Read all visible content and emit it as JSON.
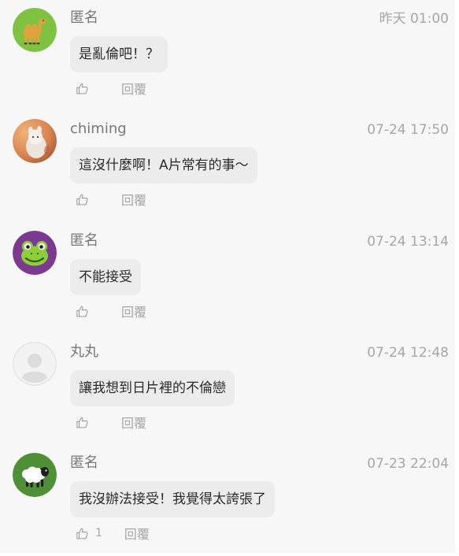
{
  "comments": [
    {
      "author": "匿名",
      "time": "昨天 01:00",
      "text": "是亂倫吧！？",
      "likes": "",
      "reply_label": "回覆",
      "avatar": {
        "icon": "camel-icon",
        "bg": "#7fc241",
        "fg": "#e0a23c"
      }
    },
    {
      "author": "chiming",
      "time": "07-24 17:50",
      "text": "這沒什麼啊！A片常有的事～",
      "likes": "",
      "reply_label": "回覆",
      "avatar": {
        "icon": "user-photo",
        "bg": "#d8824f",
        "fg": "#f3ece6"
      }
    },
    {
      "author": "匿名",
      "time": "07-24 13:14",
      "text": "不能接受",
      "likes": "",
      "reply_label": "回覆",
      "avatar": {
        "icon": "frog-icon",
        "bg": "#7b3a8f",
        "fg": "#8ccf3a"
      }
    },
    {
      "author": "丸丸",
      "time": "07-24 12:48",
      "text": "讓我想到日片裡的不倫戀",
      "likes": "",
      "reply_label": "回覆",
      "avatar": {
        "icon": "default-user-icon",
        "bg": "#f2f2f2",
        "fg": "#dddddd"
      }
    },
    {
      "author": "匿名",
      "time": "07-23 22:04",
      "text": "我沒辦法接受！我覺得太誇張了",
      "likes": "1",
      "reply_label": "回覆",
      "avatar": {
        "icon": "sheep-icon",
        "bg": "#4f8f35",
        "fg": "#ffffff"
      }
    }
  ]
}
